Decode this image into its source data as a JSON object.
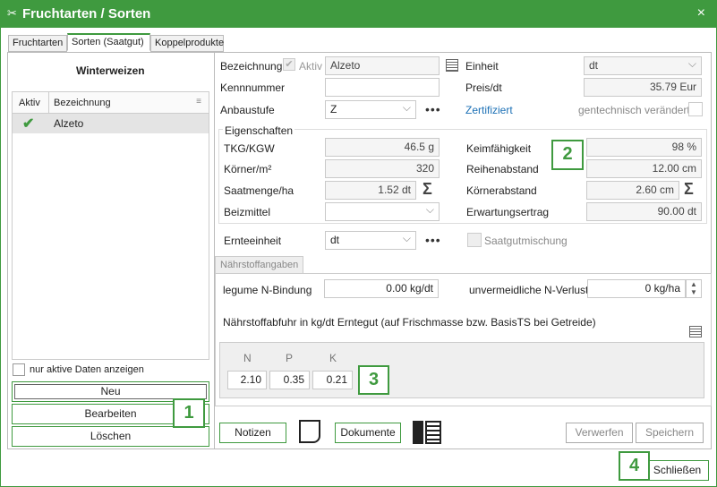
{
  "window": {
    "title": "Fruchtarten / Sorten",
    "close_label": "×"
  },
  "tabs": [
    "Fruchtarten",
    "Sorten (Saatgut)",
    "Koppelprodukte"
  ],
  "left": {
    "group_title": "Winterweizen",
    "col_aktiv": "Aktiv",
    "col_bezeichnung": "Bezeichnung",
    "rows": [
      {
        "aktiv": "✔",
        "bezeichnung": "Alzeto"
      }
    ],
    "only_active_label": "nur aktive Daten anzeigen",
    "btn_new": "Neu",
    "btn_edit": "Bearbeiten",
    "btn_delete": "Löschen"
  },
  "form": {
    "bezeichnung_label": "Bezeichnung",
    "aktiv_label": "Aktiv",
    "bezeichnung_value": "Alzeto",
    "einheit_label": "Einheit",
    "einheit_value": "dt",
    "kennnummer_label": "Kennnummer",
    "kennnummer_value": "",
    "preis_label": "Preis/dt",
    "preis_value": "35.79 Eur",
    "anbaustufe_label": "Anbaustufe",
    "anbaustufe_value": "Z",
    "dots": "•••",
    "zertifiziert_label": "Zertifiziert",
    "gentech_label": "gentechnisch verändert",
    "eigenschaften_label": "Eigenschaften",
    "tkg_label": "TKG/KGW",
    "tkg_value": "46.5 g",
    "keim_label": "Keimfähigkeit",
    "keim_value": "98 %",
    "koerner_label": "Körner/m²",
    "koerner_value": "320",
    "reihen_label": "Reihenabstand",
    "reihen_value": "12.00 cm",
    "saat_label": "Saatmenge/ha",
    "saat_value": "1.52 dt",
    "koernerab_label": "Körnerabstand",
    "koernerab_value": "2.60 cm",
    "beiz_label": "Beizmittel",
    "beiz_value": "",
    "erwart_label": "Erwartungsertrag",
    "erwart_value": "90.00 dt",
    "ernte_label": "Ernteeinheit",
    "ernte_value": "dt",
    "saatgut_label": "Saatgutmischung",
    "sigma": "Σ"
  },
  "naehr": {
    "tab_label": "Nährstoffangaben",
    "legume_label": "legume N-Bindung",
    "legume_value": "0.00 kg/dt",
    "verluste_label": "unvermeidliche N-Verluste",
    "verluste_value": "0 kg/ha",
    "abfuhr_label": "Nährstoffabfuhr in kg/dt Erntegut (auf Frischmasse bzw. BasisTS bei Getreide)",
    "headers": [
      "N",
      "P",
      "K"
    ],
    "values": [
      "2.10",
      "0.35",
      "0.21"
    ]
  },
  "bottom": {
    "notizen": "Notizen",
    "dokumente": "Dokumente",
    "verwerfen": "Verwerfen",
    "speichern": "Speichern",
    "schliessen": "Schließen"
  },
  "badges": [
    "1",
    "2",
    "3",
    "4"
  ],
  "colors": {
    "accent": "#3f9a3f"
  }
}
